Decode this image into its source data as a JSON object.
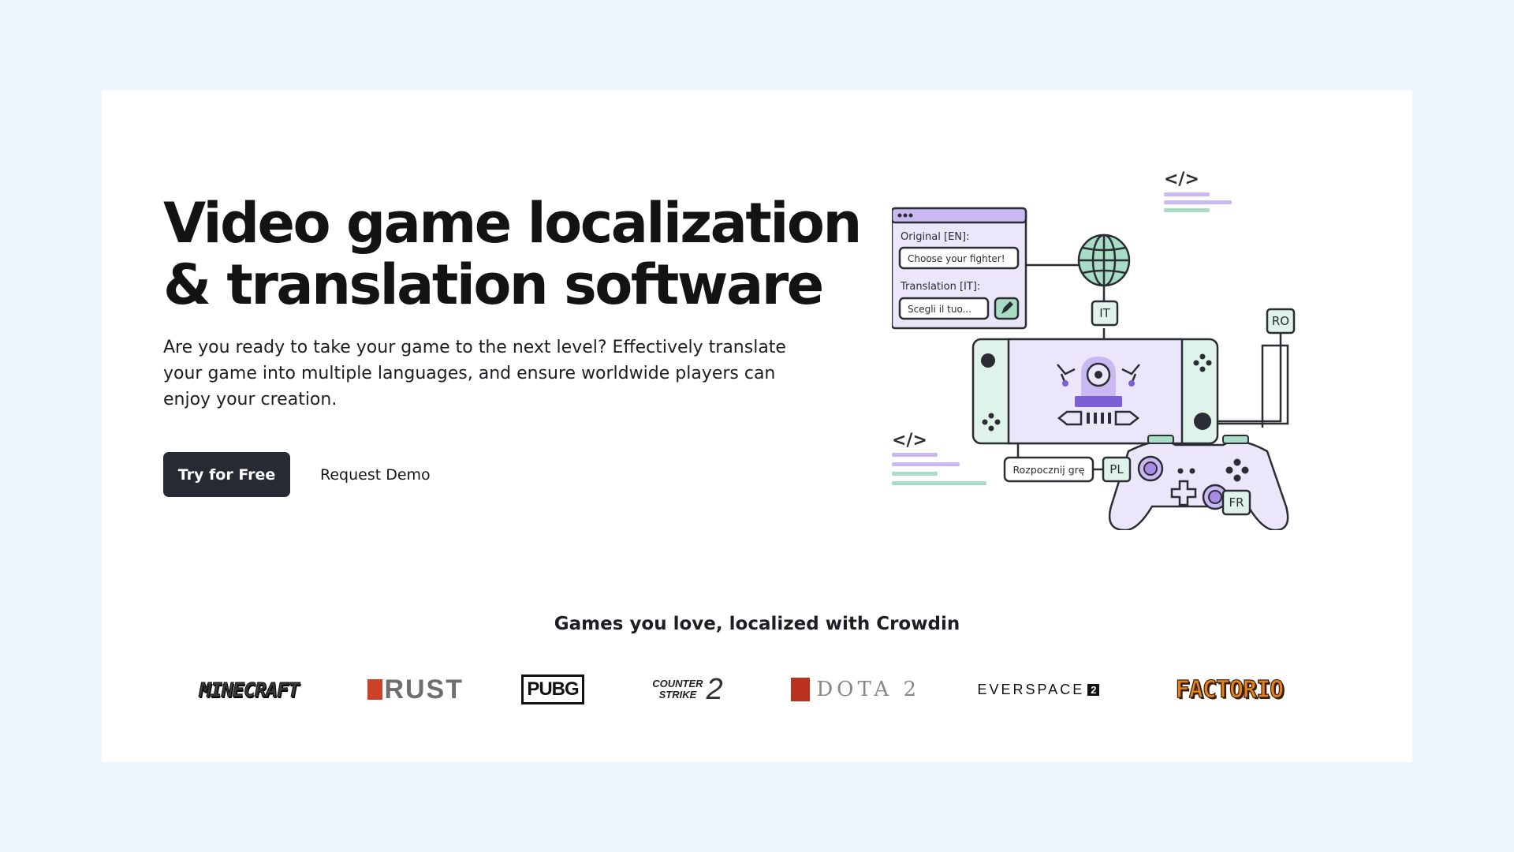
{
  "hero": {
    "title_line1": "Video game localization",
    "title_line2": "& translation software",
    "subtitle": "Are you ready to take your game to the next level? Effectively translate your game into multiple languages, and ensure worldwide players can enjoy your creation.",
    "primary_cta": "Try for Free",
    "secondary_cta": "Request Demo"
  },
  "illustration": {
    "original_label": "Original [EN]:",
    "original_value": "Choose your fighter!",
    "translation_label": "Translation [IT]:",
    "translation_value": "Scegli il tuo...",
    "tag_it": "IT",
    "tag_ro": "RO",
    "tag_pl": "PL",
    "tag_fr": "FR",
    "polish_text": "Rozpocznij grę",
    "code_symbol": "</>",
    "colors": {
      "purple": "#c9b8f2",
      "purple_light": "#ece6fb",
      "purple_dark": "#7c5fd6",
      "green": "#a8dcc4",
      "green_light": "#dff3ea",
      "outline": "#2a2d33"
    }
  },
  "games": {
    "heading": "Games you love, localized with Crowdin",
    "logos": {
      "minecraft": "MINECRAFT",
      "rust": "RUST",
      "pubg": "PUBG",
      "cs_line1": "COUNTER",
      "cs_line2": "STRIKE",
      "cs_num": "2",
      "dota": "DOTA 2",
      "everspace": "EVERSPACE",
      "everspace_num": "2",
      "factorio": "FACTORIO"
    }
  }
}
